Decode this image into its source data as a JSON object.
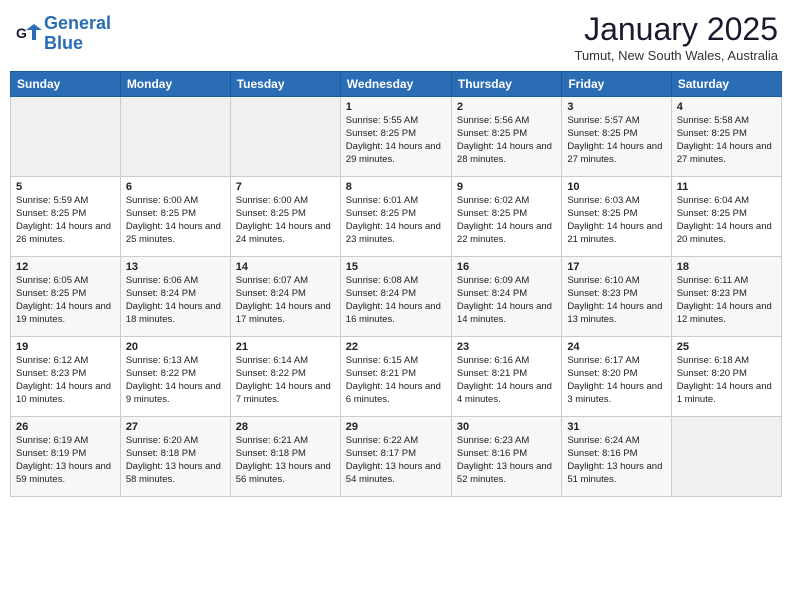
{
  "header": {
    "logo_line1": "General",
    "logo_line2": "Blue",
    "month": "January 2025",
    "location": "Tumut, New South Wales, Australia"
  },
  "weekdays": [
    "Sunday",
    "Monday",
    "Tuesday",
    "Wednesday",
    "Thursday",
    "Friday",
    "Saturday"
  ],
  "weeks": [
    [
      {
        "day": "",
        "info": ""
      },
      {
        "day": "",
        "info": ""
      },
      {
        "day": "",
        "info": ""
      },
      {
        "day": "1",
        "info": "Sunrise: 5:55 AM\nSunset: 8:25 PM\nDaylight: 14 hours and 29 minutes."
      },
      {
        "day": "2",
        "info": "Sunrise: 5:56 AM\nSunset: 8:25 PM\nDaylight: 14 hours and 28 minutes."
      },
      {
        "day": "3",
        "info": "Sunrise: 5:57 AM\nSunset: 8:25 PM\nDaylight: 14 hours and 27 minutes."
      },
      {
        "day": "4",
        "info": "Sunrise: 5:58 AM\nSunset: 8:25 PM\nDaylight: 14 hours and 27 minutes."
      }
    ],
    [
      {
        "day": "5",
        "info": "Sunrise: 5:59 AM\nSunset: 8:25 PM\nDaylight: 14 hours and 26 minutes."
      },
      {
        "day": "6",
        "info": "Sunrise: 6:00 AM\nSunset: 8:25 PM\nDaylight: 14 hours and 25 minutes."
      },
      {
        "day": "7",
        "info": "Sunrise: 6:00 AM\nSunset: 8:25 PM\nDaylight: 14 hours and 24 minutes."
      },
      {
        "day": "8",
        "info": "Sunrise: 6:01 AM\nSunset: 8:25 PM\nDaylight: 14 hours and 23 minutes."
      },
      {
        "day": "9",
        "info": "Sunrise: 6:02 AM\nSunset: 8:25 PM\nDaylight: 14 hours and 22 minutes."
      },
      {
        "day": "10",
        "info": "Sunrise: 6:03 AM\nSunset: 8:25 PM\nDaylight: 14 hours and 21 minutes."
      },
      {
        "day": "11",
        "info": "Sunrise: 6:04 AM\nSunset: 8:25 PM\nDaylight: 14 hours and 20 minutes."
      }
    ],
    [
      {
        "day": "12",
        "info": "Sunrise: 6:05 AM\nSunset: 8:25 PM\nDaylight: 14 hours and 19 minutes."
      },
      {
        "day": "13",
        "info": "Sunrise: 6:06 AM\nSunset: 8:24 PM\nDaylight: 14 hours and 18 minutes."
      },
      {
        "day": "14",
        "info": "Sunrise: 6:07 AM\nSunset: 8:24 PM\nDaylight: 14 hours and 17 minutes."
      },
      {
        "day": "15",
        "info": "Sunrise: 6:08 AM\nSunset: 8:24 PM\nDaylight: 14 hours and 16 minutes."
      },
      {
        "day": "16",
        "info": "Sunrise: 6:09 AM\nSunset: 8:24 PM\nDaylight: 14 hours and 14 minutes."
      },
      {
        "day": "17",
        "info": "Sunrise: 6:10 AM\nSunset: 8:23 PM\nDaylight: 14 hours and 13 minutes."
      },
      {
        "day": "18",
        "info": "Sunrise: 6:11 AM\nSunset: 8:23 PM\nDaylight: 14 hours and 12 minutes."
      }
    ],
    [
      {
        "day": "19",
        "info": "Sunrise: 6:12 AM\nSunset: 8:23 PM\nDaylight: 14 hours and 10 minutes."
      },
      {
        "day": "20",
        "info": "Sunrise: 6:13 AM\nSunset: 8:22 PM\nDaylight: 14 hours and 9 minutes."
      },
      {
        "day": "21",
        "info": "Sunrise: 6:14 AM\nSunset: 8:22 PM\nDaylight: 14 hours and 7 minutes."
      },
      {
        "day": "22",
        "info": "Sunrise: 6:15 AM\nSunset: 8:21 PM\nDaylight: 14 hours and 6 minutes."
      },
      {
        "day": "23",
        "info": "Sunrise: 6:16 AM\nSunset: 8:21 PM\nDaylight: 14 hours and 4 minutes."
      },
      {
        "day": "24",
        "info": "Sunrise: 6:17 AM\nSunset: 8:20 PM\nDaylight: 14 hours and 3 minutes."
      },
      {
        "day": "25",
        "info": "Sunrise: 6:18 AM\nSunset: 8:20 PM\nDaylight: 14 hours and 1 minute."
      }
    ],
    [
      {
        "day": "26",
        "info": "Sunrise: 6:19 AM\nSunset: 8:19 PM\nDaylight: 13 hours and 59 minutes."
      },
      {
        "day": "27",
        "info": "Sunrise: 6:20 AM\nSunset: 8:18 PM\nDaylight: 13 hours and 58 minutes."
      },
      {
        "day": "28",
        "info": "Sunrise: 6:21 AM\nSunset: 8:18 PM\nDaylight: 13 hours and 56 minutes."
      },
      {
        "day": "29",
        "info": "Sunrise: 6:22 AM\nSunset: 8:17 PM\nDaylight: 13 hours and 54 minutes."
      },
      {
        "day": "30",
        "info": "Sunrise: 6:23 AM\nSunset: 8:16 PM\nDaylight: 13 hours and 52 minutes."
      },
      {
        "day": "31",
        "info": "Sunrise: 6:24 AM\nSunset: 8:16 PM\nDaylight: 13 hours and 51 minutes."
      },
      {
        "day": "",
        "info": ""
      }
    ]
  ]
}
